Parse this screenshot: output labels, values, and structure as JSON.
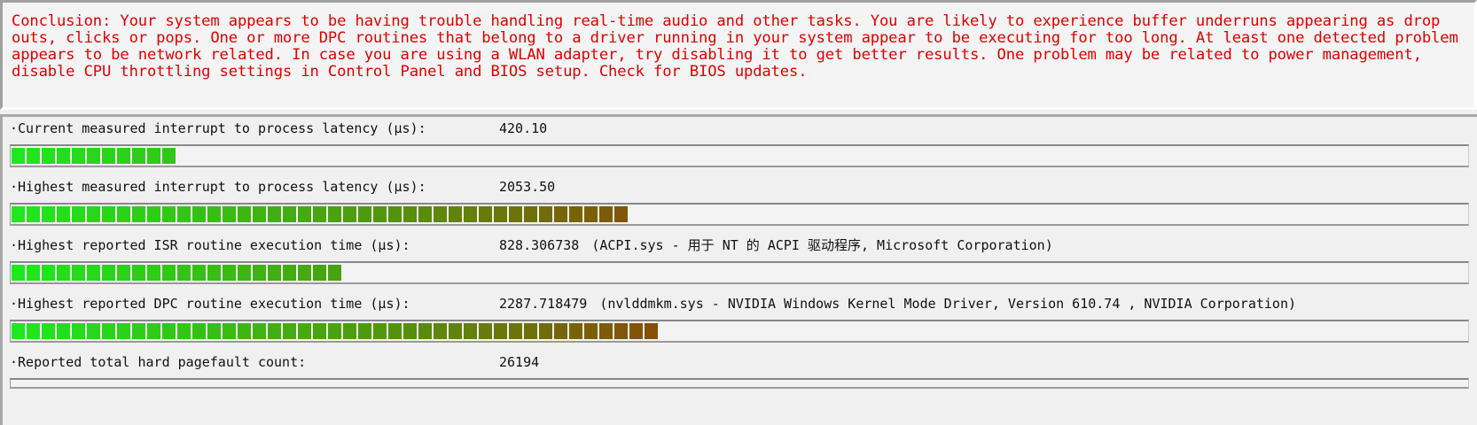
{
  "conclusion": {
    "text": "Conclusion: Your system appears to be having trouble handling real-time audio and other tasks. You are likely to experience buffer underruns appearing as drop outs, clicks or pops. One or more DPC routines that belong to a driver running in your system appear to be executing for too long. At least one detected problem appears to be network related. In case you are using a WLAN adapter, try disabling it to get better results. One problem may be related to power management, disable CPU throttling settings in Control Panel and BIOS setup. Check for BIOS updates.",
    "color": "#e00000"
  },
  "metrics": [
    {
      "label": "·Current measured interrupt to process latency (µs):",
      "value": "420.10",
      "detail": "",
      "bar_fraction": 0.114
    },
    {
      "label": "·Highest measured interrupt to process latency (µs):",
      "value": "2053.50",
      "detail": "",
      "bar_fraction": 0.432
    },
    {
      "label": "·Highest reported ISR routine execution time (µs):",
      "value": "828.306738",
      "detail": "(ACPI.sys - 用于 NT 的 ACPI 驱动程序, Microsoft Corporation)",
      "bar_fraction": 0.23
    },
    {
      "label": "·Highest reported DPC routine execution time (µs):",
      "value": "2287.718479",
      "detail": "(nvlddmkm.sys - NVIDIA Windows Kernel Mode Driver, Version 610.74 , NVIDIA Corporation)",
      "bar_fraction": 0.451
    },
    {
      "label": "·Reported total hard pagefault count:",
      "value": "26194",
      "detail": "",
      "bar_fraction": 0
    }
  ],
  "colors": {
    "bar_start": "#1ee81e",
    "bar_mid": "#4aa010",
    "bar_end": "#8a4a06"
  }
}
